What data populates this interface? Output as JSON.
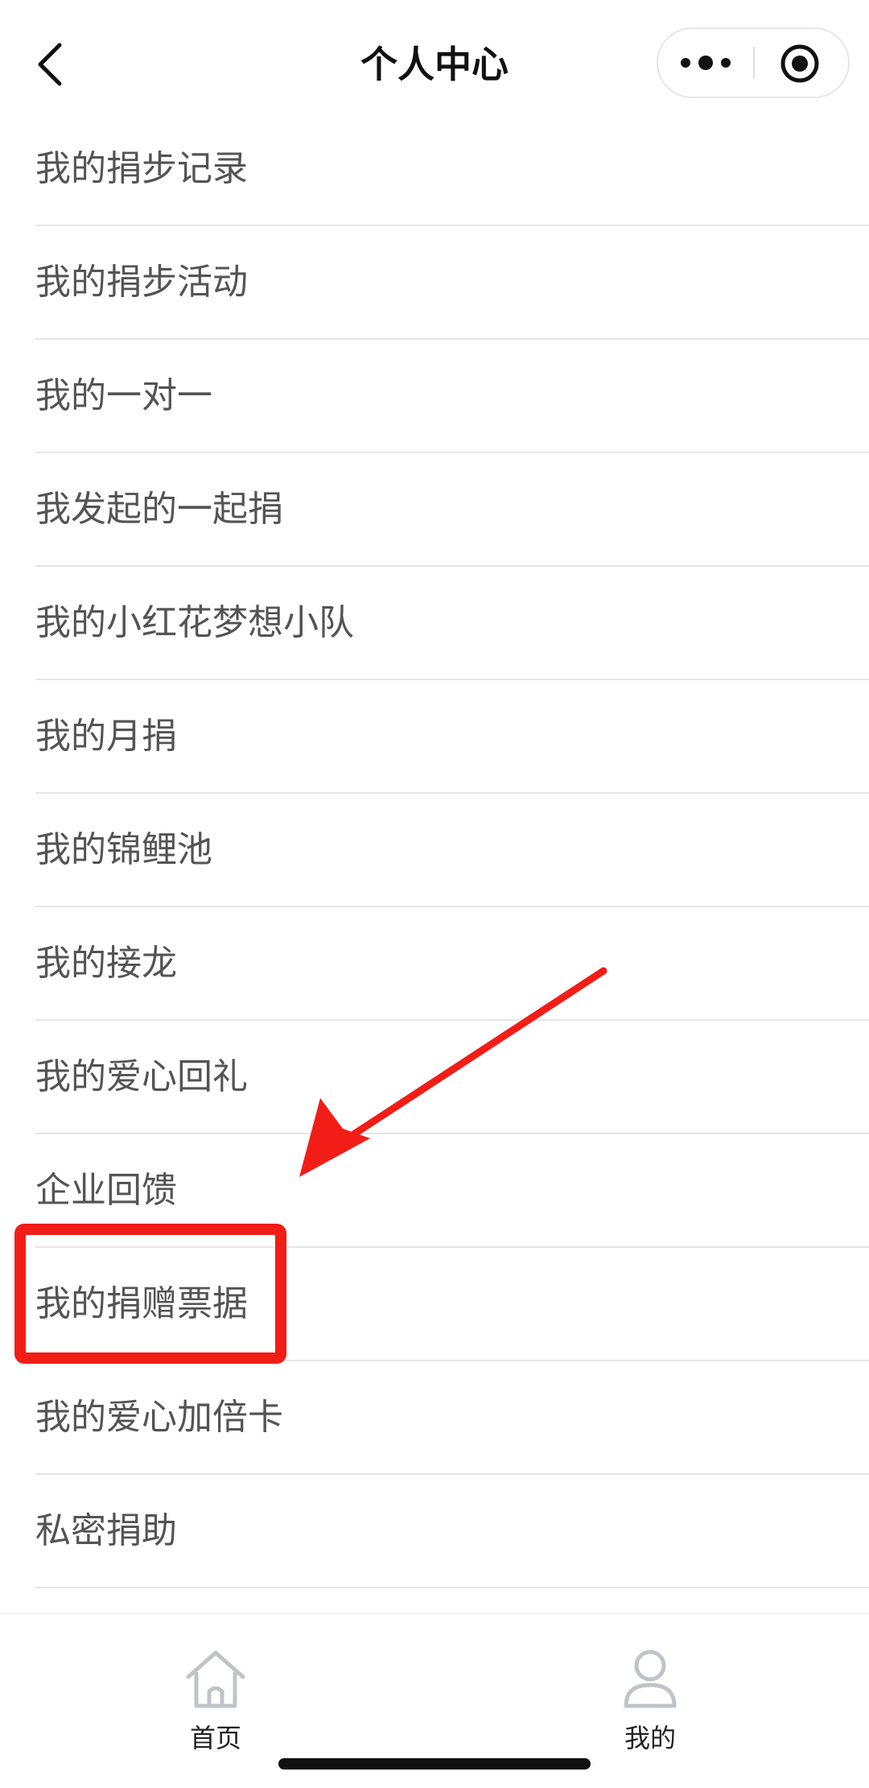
{
  "header": {
    "title": "个人中心",
    "back_icon": "chevron-left-icon",
    "more_icon": "more-dots-icon",
    "close_icon": "target-circle-icon"
  },
  "menu": {
    "items": [
      {
        "label": "我的捐步记录"
      },
      {
        "label": "我的捐步活动"
      },
      {
        "label": "我的一对一"
      },
      {
        "label": "我发起的一起捐"
      },
      {
        "label": "我的小红花梦想小队"
      },
      {
        "label": "我的月捐"
      },
      {
        "label": "我的锦鲤池"
      },
      {
        "label": "我的接龙"
      },
      {
        "label": "我的爱心回礼"
      },
      {
        "label": "企业回馈"
      },
      {
        "label": "我的捐赠票据"
      },
      {
        "label": "我的爱心加倍卡"
      },
      {
        "label": "私密捐助"
      }
    ]
  },
  "annotation": {
    "highlighted_item": "我的捐赠票据",
    "color": "#f21d17"
  },
  "tabbar": {
    "tabs": [
      {
        "label": "首页",
        "icon": "home-icon"
      },
      {
        "label": "我的",
        "icon": "user-icon"
      }
    ]
  }
}
